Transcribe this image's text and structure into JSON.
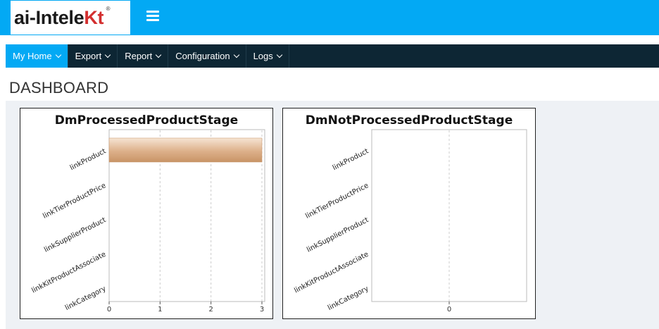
{
  "app": {
    "logo_text": "ai-InteleKt",
    "logo_prefix": "ai-Intele",
    "logo_suffix": "Kt",
    "logo_reg": "®",
    "colors": {
      "topbar": "#03a9f4",
      "navbar": "#0d2634",
      "active": "#03a9f4",
      "bar": "#d4a070"
    }
  },
  "nav": {
    "items": [
      {
        "label": "My Home",
        "active": true
      },
      {
        "label": "Export",
        "active": false
      },
      {
        "label": "Report",
        "active": false
      },
      {
        "label": "Configuration",
        "active": false
      },
      {
        "label": "Logs",
        "active": false
      }
    ]
  },
  "page": {
    "title": "DASHBOARD"
  },
  "chart_data": [
    {
      "type": "bar",
      "orientation": "horizontal",
      "title": "DmProcessedProductStage",
      "categories": [
        "linkProduct",
        "linkTierProductPrice",
        "linkSupplierProduct",
        "linkKitProductAssociate",
        "linkCategory"
      ],
      "values": [
        3,
        0,
        0,
        0,
        0
      ],
      "xlim": [
        0,
        3
      ],
      "xticks": [
        "0",
        "1",
        "2",
        "3"
      ],
      "grid": true
    },
    {
      "type": "bar",
      "orientation": "horizontal",
      "title": "DmNotProcessedProductStage",
      "categories": [
        "linkProduct",
        "linkTierProductPrice",
        "linkSupplierProduct",
        "linkKitProductAssociate",
        "linkCategory"
      ],
      "values": [
        0,
        0,
        0,
        0,
        0
      ],
      "xticks": [
        "0"
      ],
      "grid": true
    }
  ]
}
